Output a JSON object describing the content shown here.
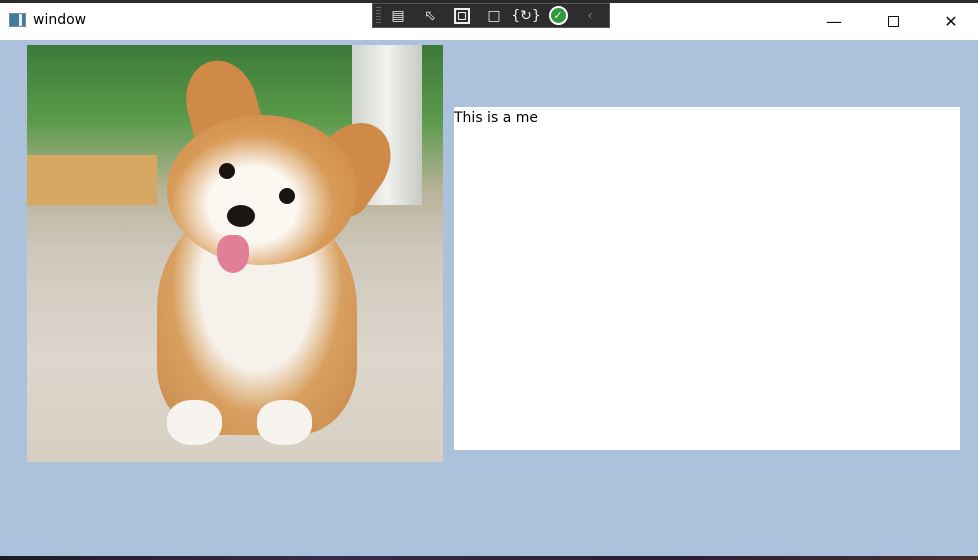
{
  "window": {
    "title": "window",
    "icon": "app-window-icon",
    "controls": [
      "minimize-icon",
      "maximize-icon",
      "close-icon"
    ],
    "background_color": "#abc1dc"
  },
  "debug_toolbar": {
    "items": [
      "live-visual-tree-icon",
      "select-element-icon",
      "display-layout-adorners-icon",
      "track-focus-icon",
      "hot-reload-icon",
      "binding-check-icon",
      "collapse-icon"
    ]
  },
  "content": {
    "image": "corgi-puppy-photo",
    "text": "This is a me"
  }
}
